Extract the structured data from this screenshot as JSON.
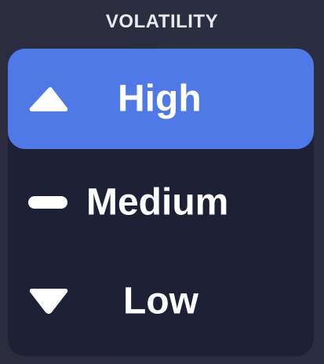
{
  "header": {
    "title": "VOLATILITY"
  },
  "options": [
    {
      "label": "High",
      "icon": "triangle-up-icon",
      "selected": true
    },
    {
      "label": "Medium",
      "icon": "dash-icon",
      "selected": false
    },
    {
      "label": "Low",
      "icon": "triangle-down-icon",
      "selected": false
    }
  ],
  "colors": {
    "background": "#2b2d3f",
    "panel": "#1e2036",
    "selected": "#4f79e6",
    "text": "#ffffff",
    "title_text": "#e9eaf0"
  }
}
